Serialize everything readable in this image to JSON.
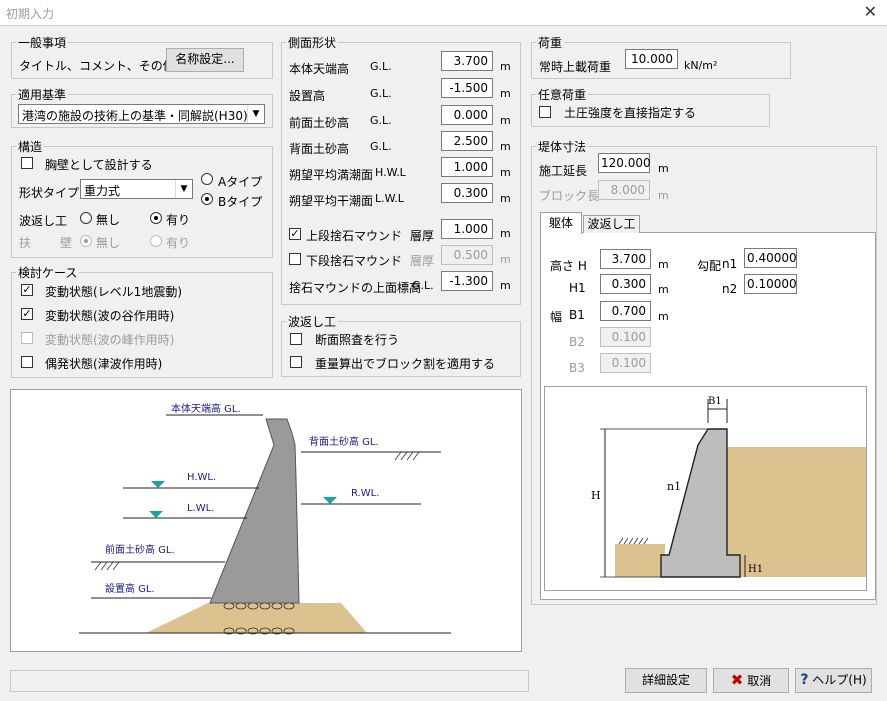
{
  "window": {
    "title": "初期入力",
    "close_glyph": "✕"
  },
  "general": {
    "legend": "一般事項",
    "label": "タイトル、コメント、その他:",
    "name_button": "名称設定..."
  },
  "standard": {
    "legend": "適用基準",
    "selected": "港湾の施設の技術上の基準・同解説(H30)"
  },
  "structure": {
    "legend": "構造",
    "parapet": {
      "label": "胸壁として設計する",
      "checked": false
    },
    "shape_label": "形状タイプ",
    "shape_selected": "重力式",
    "type_a": "Aタイプ",
    "type_b": "Bタイプ",
    "wave_label": "波返し工",
    "none": "無し",
    "present": "有り",
    "fuku_label": "扶",
    "heki_label": "壁"
  },
  "cases": {
    "legend": "検討ケース",
    "items": [
      {
        "label": "変動状態(レベル1地震動)",
        "checked": true,
        "disabled": false
      },
      {
        "label": "変動状態(波の谷作用時)",
        "checked": true,
        "disabled": false
      },
      {
        "label": "変動状態(波の峰作用時)",
        "checked": false,
        "disabled": true
      },
      {
        "label": "偶発状態(津波作用時)",
        "checked": false,
        "disabled": false
      }
    ]
  },
  "side": {
    "legend": "側面形状",
    "gl": "G.L.",
    "hwl": "H.W.L",
    "lwl": "L.W.L",
    "unit": "m",
    "rows": [
      {
        "label": "本体天端高",
        "value": "3.700"
      },
      {
        "label": "設置高",
        "value": "-1.500"
      },
      {
        "label": "前面土砂高",
        "value": "0.000"
      },
      {
        "label": "背面土砂高",
        "value": "2.500"
      },
      {
        "label": "朔望平均満潮面",
        "value": "1.000"
      },
      {
        "label": "朔望平均干潮面",
        "value": "0.300"
      }
    ],
    "upper_mound": {
      "label": "上段捨石マウンド",
      "checked": true,
      "layer": "層厚",
      "value": "1.000"
    },
    "lower_mound": {
      "label": "下段捨石マウンド",
      "checked": false,
      "layer": "層厚",
      "value": "0.500"
    },
    "mound_top": {
      "label": "捨石マウンドの上面標高",
      "value": "-1.300"
    }
  },
  "wave_work": {
    "legend": "波返し工",
    "section_check": "断面照査を行う",
    "block_split": "重量算出でブロック割を適用する"
  },
  "load": {
    "legend": "荷重",
    "label": "常時上載荷重",
    "value": "10.000",
    "unit": "kN/m²"
  },
  "optional_load": {
    "legend": "任意荷重",
    "label": "土圧強度を直接指定する"
  },
  "dimensions": {
    "legend": "堤体寸法",
    "length_label": "施工延長",
    "length_value": "120.000",
    "block_label": "ブロック長",
    "block_value": "8.000",
    "unit": "m",
    "tab_body": "躯体",
    "tab_wave": "波返し工",
    "height_label": "高さ H",
    "height_value": "3.700",
    "h1_label": "H1",
    "h1_value": "0.300",
    "width_label": "幅",
    "b1_label": "B1",
    "b1_value": "0.700",
    "b2_label": "B2",
    "b2_value": "0.100",
    "b3_label": "B3",
    "b3_value": "0.100",
    "slope_label": "勾配",
    "n1_label": "n1",
    "n1_value": "0.40000",
    "n2_label": "n2",
    "n2_value": "0.10000"
  },
  "diagram_left": {
    "top_label": "本体天端高 GL.",
    "back_label": "背面土砂高 GL.",
    "hwl": "H.WL.",
    "lwl": "L.WL.",
    "rwl": "R.WL.",
    "front_label": "前面土砂高 GL.",
    "base_label": "設置高 GL."
  },
  "diagram_right": {
    "b1": "B1",
    "h": "H",
    "n1": "n1",
    "h1": "H1"
  },
  "footer": {
    "detail": "詳細設定",
    "cancel": "取消",
    "help": "ヘルプ(H)"
  },
  "colors": {
    "soil": "#dcc28f",
    "concrete": "#9a9a9a",
    "water": "#1aa3a3",
    "label_blue": "#1a1a8c"
  }
}
